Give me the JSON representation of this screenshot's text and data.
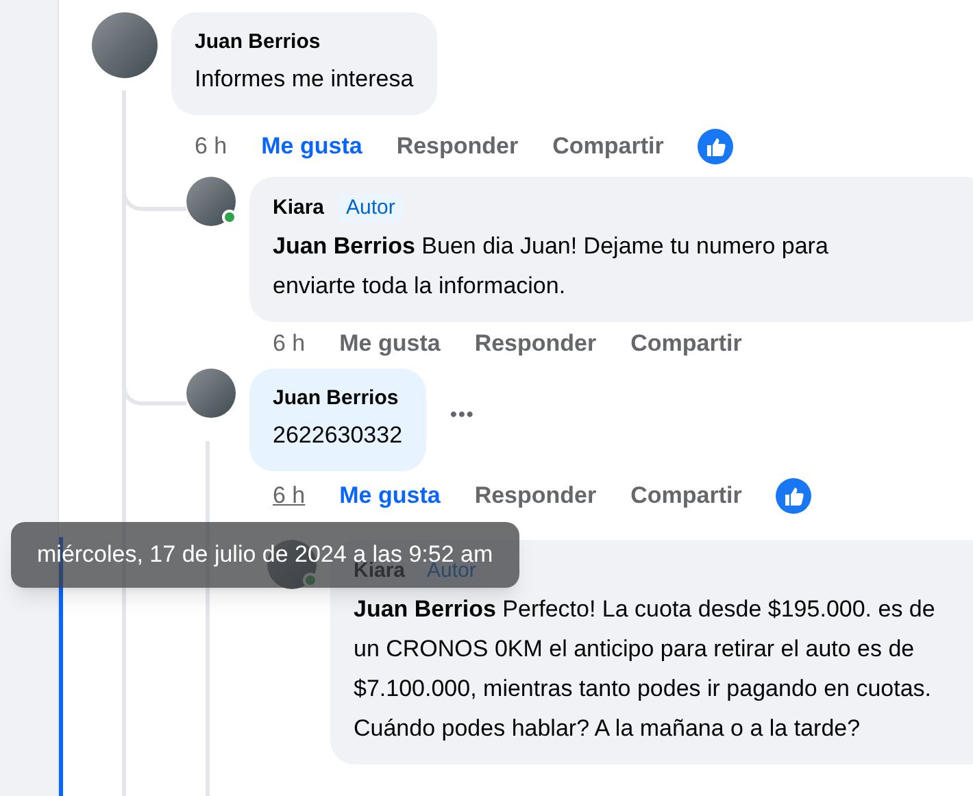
{
  "comments": [
    {
      "author": "Juan Berrios",
      "text": "Informes me interesa",
      "time": "6 h",
      "time_hovered": false,
      "like": "Me gusta",
      "liked": true,
      "reply": "Responder",
      "share": "Compartir",
      "reaction": true,
      "replies": [
        {
          "author": "Kiara",
          "badge": "Autor",
          "text": "**Juan Berrios** Buen dia Juan! Dejame tu numero para enviarte toda la informacion.",
          "time": "6 h",
          "time_hovered": false,
          "like": "Me gusta",
          "liked": false,
          "reply": "Responder",
          "share": "Compartir",
          "reaction": false,
          "online": true
        },
        {
          "author": "Juan Berrios",
          "text": "2622630332",
          "time": "6 h",
          "time_hovered": true,
          "like": "Me gusta",
          "liked": true,
          "reply": "Responder",
          "share": "Compartir",
          "reaction": true,
          "highlighted": true,
          "more": "•••",
          "replies": [
            {
              "author": "Kiara",
              "badge": "Autor",
              "text": "**Juan Berrios** Perfecto! La cuota desde $195.000. es de un CRONOS 0KM el anticipo para retirar el auto es de $7.100.000, mientras tanto podes ir pagando en cuotas. Cuándo podes hablar? A la mañana o a la tarde?",
              "online": true
            }
          ]
        }
      ]
    }
  ],
  "tooltip": {
    "text": "miércoles, 17 de julio de 2024 a las 9:52 am"
  }
}
